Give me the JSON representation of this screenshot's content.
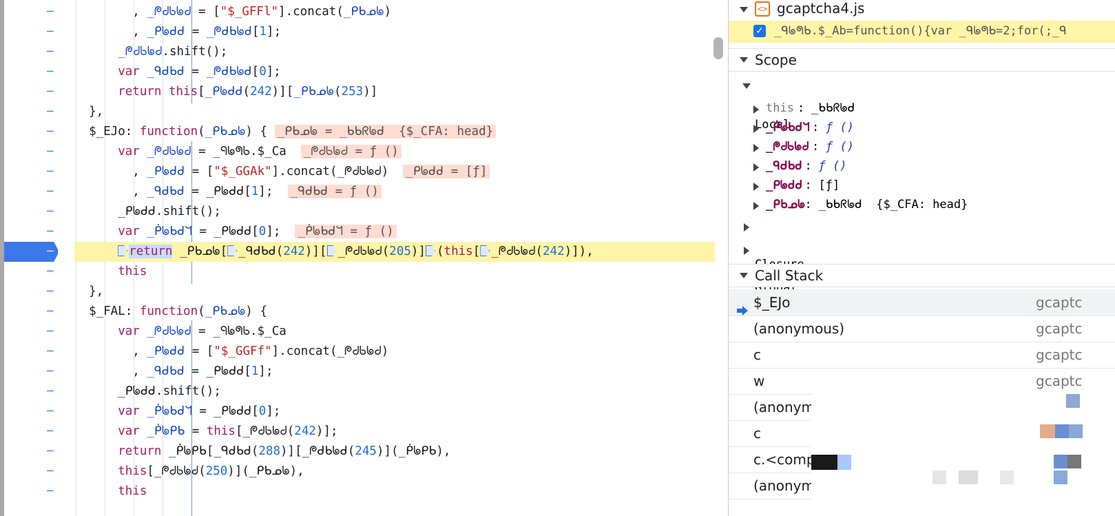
{
  "editor": {
    "code_lines": [
      {
        "seg": [
          [
            "p",
            "        , "
          ],
          [
            "nm",
            "_ᖘᑯᑲᖚᑯ"
          ],
          [
            "p",
            " = ["
          ],
          [
            "str",
            "\"$_GFFl\""
          ],
          [
            "p",
            "].concat("
          ],
          [
            "nm",
            "_ᑭᑲᓄᖚ"
          ],
          [
            "p",
            ")"
          ]
        ]
      },
      {
        "seg": [
          [
            "p",
            "        , "
          ],
          [
            "nm",
            "_ᑭᖚᑯᑯ"
          ],
          [
            "p",
            " = "
          ],
          [
            "nm",
            "_ᖘᑯᑲᖚᑯ"
          ],
          [
            "p",
            "["
          ],
          [
            "num",
            "1"
          ],
          [
            "p",
            "];"
          ]
        ]
      },
      {
        "seg": [
          [
            "p",
            "      "
          ],
          [
            "nm",
            "_ᖘᑯᑲᖚᑯ"
          ],
          [
            "p",
            ".shift();"
          ]
        ]
      },
      {
        "seg": [
          [
            "p",
            "      "
          ],
          [
            "kw",
            "var"
          ],
          [
            "p",
            " "
          ],
          [
            "nm",
            "_ᑫᑯᑲᑯ"
          ],
          [
            "p",
            " = "
          ],
          [
            "nm",
            "_ᖘᑯᑲᖚᑯ"
          ],
          [
            "p",
            "["
          ],
          [
            "num",
            "0"
          ],
          [
            "p",
            "];"
          ]
        ]
      },
      {
        "seg": [
          [
            "p",
            "      "
          ],
          [
            "kw",
            "return this"
          ],
          [
            "p",
            "["
          ],
          [
            "nm",
            "_ᑭᖚᑯᑯ"
          ],
          [
            "p",
            "("
          ],
          [
            "num",
            "242"
          ],
          [
            "p",
            ")]["
          ],
          [
            "nm",
            "_ᑭᑲᓄᖚ"
          ],
          [
            "p",
            "("
          ],
          [
            "num",
            "253"
          ],
          [
            "p",
            ")]"
          ]
        ]
      },
      {
        "seg": [
          [
            "p",
            "  },"
          ]
        ]
      },
      {
        "seg": [
          [
            "p",
            "  $_EJo: "
          ],
          [
            "kw",
            "function"
          ],
          [
            "p",
            "("
          ],
          [
            "nm",
            "_ᑭᑲᓄᖚ"
          ],
          [
            "p",
            ") { "
          ],
          [
            "inl",
            "_ᑭᑲᓄᖚ = _ᑲᑲᖇᖚᑯ  {$_CFA: head}"
          ]
        ]
      },
      {
        "seg": [
          [
            "p",
            "      "
          ],
          [
            "kw",
            "var"
          ],
          [
            "p",
            " "
          ],
          [
            "nm",
            "_ᖘᑯᑲᖚᑯ"
          ],
          [
            "p",
            " = _ᑫᖚᖗᑲ.$_Ca  "
          ],
          [
            "inl",
            "_ᖘᑯᑲᖚᑯ = ƒ ()"
          ]
        ]
      },
      {
        "seg": [
          [
            "p",
            "        , "
          ],
          [
            "nm",
            "_ᑭᖚᑯᑯ"
          ],
          [
            "p",
            " = ["
          ],
          [
            "str",
            "\"$_GGAk\""
          ],
          [
            "p",
            "].concat(_ᖘᑯᑲᖚᑯ)  "
          ],
          [
            "inl",
            "_ᑭᖚᑯᑯ = [ƒ]"
          ]
        ]
      },
      {
        "seg": [
          [
            "p",
            "        , "
          ],
          [
            "nm",
            "_ᑫᑯᑲᑯ"
          ],
          [
            "p",
            " = _ᑭᖚᑯᑯ["
          ],
          [
            "num",
            "1"
          ],
          [
            "p",
            "];  "
          ],
          [
            "inl",
            "_ᑫᑯᑲᑯ = ƒ ()"
          ]
        ]
      },
      {
        "seg": [
          [
            "p",
            "      _ᑭᖚᑯᑯ.shift();"
          ]
        ]
      },
      {
        "seg": [
          [
            "p",
            "      "
          ],
          [
            "kw",
            "var"
          ],
          [
            "p",
            " "
          ],
          [
            "nm",
            "_ᑮᖚᑲᑯᖻ"
          ],
          [
            "p",
            " = _ᑭᖚᑯᑯ["
          ],
          [
            "num",
            "0"
          ],
          [
            "p",
            "];  "
          ],
          [
            "inl",
            "_ᑮᖚᑲᑯᖻ = ƒ ()"
          ]
        ]
      },
      {
        "seg": [
          [
            "p",
            "      "
          ],
          [
            "mk",
            ""
          ],
          [
            "kwsel",
            "return"
          ],
          [
            "p",
            " _ᑭᑲᓄᖚ["
          ],
          [
            "mk",
            ""
          ],
          [
            "p",
            "_ᑫᑯᑲᑯ("
          ],
          [
            "num",
            "242"
          ],
          [
            "p",
            ")]["
          ],
          [
            "mk",
            ""
          ],
          [
            "p",
            "_ᖘᑯᑲᖚᑯ("
          ],
          [
            "num",
            "205"
          ],
          [
            "p",
            ")]"
          ],
          [
            "mk",
            ""
          ],
          [
            "p",
            "("
          ],
          [
            "kw",
            "this"
          ],
          [
            "p",
            "["
          ],
          [
            "mk",
            ""
          ],
          [
            "p",
            "_ᖘᑯᑲᖚᑯ("
          ],
          [
            "num",
            "242"
          ],
          [
            "p",
            ")]),"
          ]
        ],
        "exec": true
      },
      {
        "seg": [
          [
            "p",
            "      "
          ],
          [
            "kw",
            "this"
          ]
        ]
      },
      {
        "seg": [
          [
            "p",
            "  },"
          ]
        ]
      },
      {
        "seg": [
          [
            "p",
            "  $_FAL: "
          ],
          [
            "kw",
            "function"
          ],
          [
            "p",
            "("
          ],
          [
            "nm",
            "_ᑭᑲᓄᖚ"
          ],
          [
            "p",
            ") {"
          ]
        ]
      },
      {
        "seg": [
          [
            "p",
            "      "
          ],
          [
            "kw",
            "var"
          ],
          [
            "p",
            " "
          ],
          [
            "nm",
            "_ᖘᑯᑲᖚᑯ"
          ],
          [
            "p",
            " = _ᑫᖚᖗᑲ.$_Ca"
          ]
        ]
      },
      {
        "seg": [
          [
            "p",
            "        , "
          ],
          [
            "nm",
            "_ᑭᖚᑯᑯ"
          ],
          [
            "p",
            " = ["
          ],
          [
            "str",
            "\"$_GGFf\""
          ],
          [
            "p",
            "].concat(_ᖘᑯᑲᖚᑯ)"
          ]
        ]
      },
      {
        "seg": [
          [
            "p",
            "        , "
          ],
          [
            "nm",
            "_ᑫᑯᑲᑯ"
          ],
          [
            "p",
            " = _ᑭᖚᑯᑯ["
          ],
          [
            "num",
            "1"
          ],
          [
            "p",
            "];"
          ]
        ]
      },
      {
        "seg": [
          [
            "p",
            "      _ᑭᖚᑯᑯ.shift();"
          ]
        ]
      },
      {
        "seg": [
          [
            "p",
            "      "
          ],
          [
            "kw",
            "var"
          ],
          [
            "p",
            " "
          ],
          [
            "nm",
            "_ᑮᖚᑲᑯᖻ"
          ],
          [
            "p",
            " = _ᑭᖚᑯᑯ["
          ],
          [
            "num",
            "0"
          ],
          [
            "p",
            "];"
          ]
        ]
      },
      {
        "seg": [
          [
            "p",
            "      "
          ],
          [
            "kw",
            "var"
          ],
          [
            "p",
            " "
          ],
          [
            "nm",
            "_ᑮᖚᑭᑲ"
          ],
          [
            "p",
            " = "
          ],
          [
            "kw",
            "this"
          ],
          [
            "p",
            "[_ᖘᑯᑲᖚᑯ("
          ],
          [
            "num",
            "242"
          ],
          [
            "p",
            ")];"
          ]
        ]
      },
      {
        "seg": [
          [
            "p",
            "      "
          ],
          [
            "kw",
            "return"
          ],
          [
            "p",
            " _ᑮᖚᑭᑲ[_ᑫᑯᑲᑯ("
          ],
          [
            "num",
            "288"
          ],
          [
            "p",
            ")][_ᖘᑯᑲᖚᑯ("
          ],
          [
            "num",
            "245"
          ],
          [
            "p",
            ")](_ᑮᖚᑭᑲ),"
          ]
        ]
      },
      {
        "seg": [
          [
            "p",
            "      "
          ],
          [
            "kw",
            "this"
          ],
          [
            "p",
            "[_ᖘᑯᑲᖚᑯ("
          ],
          [
            "num",
            "250"
          ],
          [
            "p",
            ")](_ᑭᑲᓄᖚ),"
          ]
        ]
      },
      {
        "seg": [
          [
            "p",
            "      "
          ],
          [
            "kw",
            "this"
          ]
        ]
      }
    ]
  },
  "panel": {
    "file": {
      "name": "gcaptcha4.js",
      "breakpoint_text": "_ᑫᖚᖗᑲ.$_Ab=function(){var _ᑫᖚᖗᑲ=2;for(;_ᑫ"
    },
    "scope": {
      "title": "Scope",
      "local_label": "Local",
      "vars": [
        {
          "name": "this",
          "value": "_ᑲᑲᖇᖚᑯ",
          "muted": true,
          "kind": "obj"
        },
        {
          "name": "_ᑮᖚᑲᑯᖻ",
          "value": "ƒ ()",
          "kind": "fn"
        },
        {
          "name": "_ᖘᑯᑲᖚᑯ",
          "value": "ƒ ()",
          "kind": "fn"
        },
        {
          "name": "_ᑫᑯᑲᑯ",
          "value": "ƒ ()",
          "kind": "fn"
        },
        {
          "name": "_ᑭᖚᑯᑯ",
          "value": "[ƒ]",
          "kind": "arr"
        },
        {
          "name": "_ᑭᑲᓄᖚ",
          "value": "_ᑲᑲᖇᖚᑯ  {$_CFA: head}",
          "kind": "obj"
        }
      ],
      "closure_label": "Closure",
      "global_label": "Global"
    },
    "call_stack": {
      "title": "Call Stack",
      "frames": [
        {
          "name": "$_EJo",
          "loc": "gcaptc",
          "current": true
        },
        {
          "name": "(anonymous)",
          "loc": "gcaptc"
        },
        {
          "name": "c",
          "loc": "gcaptc"
        },
        {
          "name": "w",
          "loc": "gcaptc"
        },
        {
          "name": "(anonym",
          "loc": ""
        },
        {
          "name": "c",
          "loc": ""
        },
        {
          "name": "c.<comp",
          "loc": ""
        },
        {
          "name": "(anonym",
          "loc": ""
        }
      ]
    },
    "colors": {
      "accent": "#1a73e8",
      "highlight": "#fef5a8",
      "inline_value": "#ffdcd2"
    }
  }
}
